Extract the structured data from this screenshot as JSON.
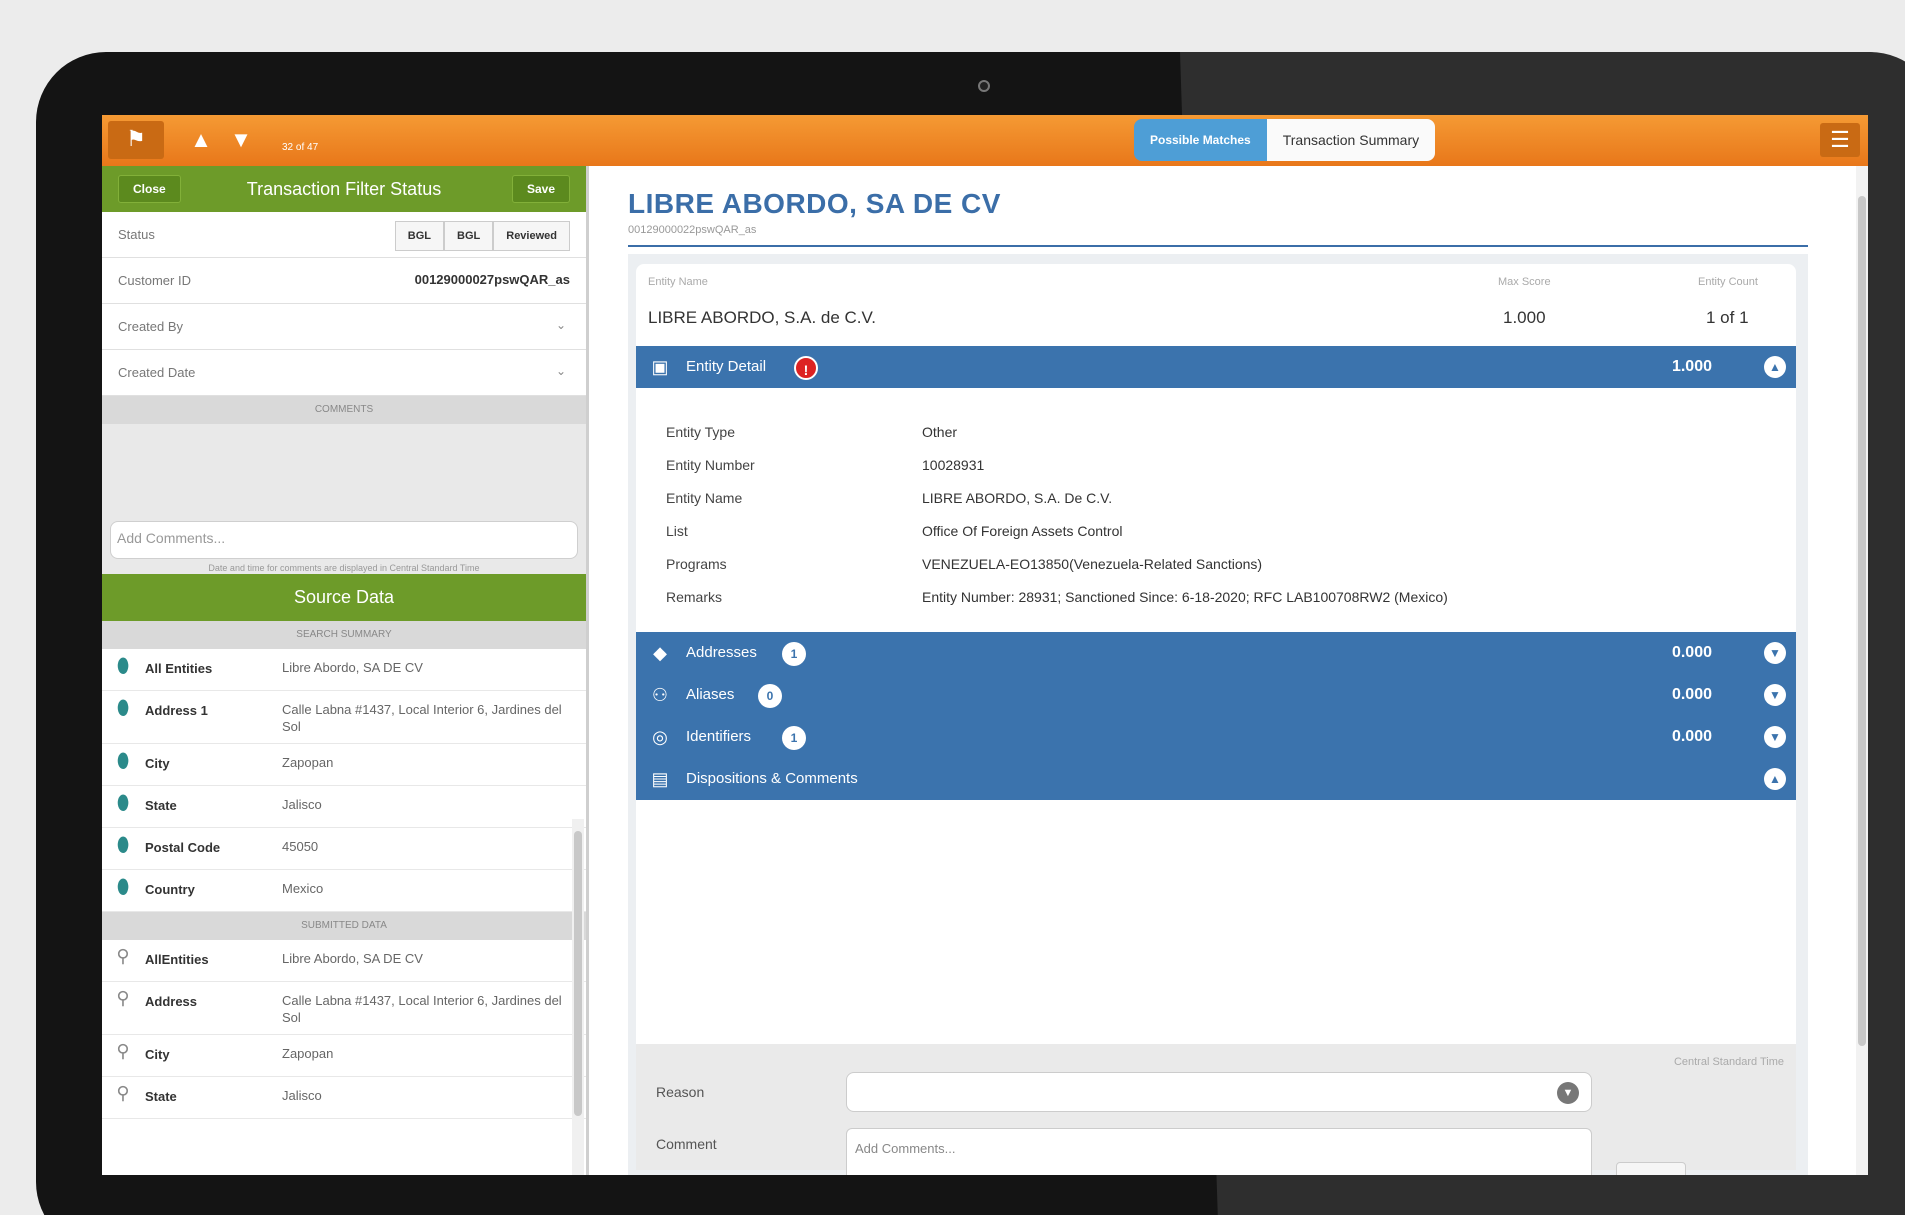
{
  "topbar": {
    "flag_icon": "flag-icon",
    "counter": "32 of 47",
    "tabs": [
      {
        "label": "Possible Matches",
        "active": true
      },
      {
        "label": "Transaction Summary",
        "active": false
      }
    ],
    "menu_icon": "hamburger-menu-icon"
  },
  "filter": {
    "close_label": "Close",
    "title": "Transaction Filter Status",
    "save_label": "Save",
    "status_label": "Status",
    "status_buttons": [
      "BGL",
      "BGL",
      "Reviewed"
    ],
    "customer_id_label": "Customer ID",
    "customer_id_value": "00129000027pswQAR_as",
    "created_by_label": "Created By",
    "created_date_label": "Created Date",
    "comments_header": "COMMENTS",
    "comment_placeholder": "Add Comments...",
    "comment_note": "Date and time for comments are displayed in Central Standard Time"
  },
  "source": {
    "title": "Source Data",
    "search_summary_header": "SEARCH SUMMARY",
    "search_rows": [
      {
        "key": "All Entities",
        "value": "Libre Abordo, SA DE CV"
      },
      {
        "key": "Address 1",
        "value": "Calle Labna #1437, Local Interior 6, Jardines del Sol"
      },
      {
        "key": "City",
        "value": "Zapopan"
      },
      {
        "key": "State",
        "value": "Jalisco"
      },
      {
        "key": "Postal Code",
        "value": "45050"
      },
      {
        "key": "Country",
        "value": "Mexico"
      }
    ],
    "submitted_header": "SUBMITTED DATA",
    "submitted_rows": [
      {
        "key": "AllEntities",
        "value": "Libre Abordo, SA DE CV"
      },
      {
        "key": "Address",
        "value": "Calle Labna #1437, Local Interior 6, Jardines del Sol"
      },
      {
        "key": "City",
        "value": "Zapopan"
      },
      {
        "key": "State",
        "value": "Jalisco"
      }
    ]
  },
  "main": {
    "title": "LIBRE ABORDO, SA DE CV",
    "subtitle": "00129000022pswQAR_as",
    "entity_name_label": "Entity Name",
    "entity_name_value": "LIBRE ABORDO, S.A. de C.V.",
    "max_score_label": "Max Score",
    "max_score_value": "1.000",
    "entity_count_label": "Entity Count",
    "entity_count_value": "1 of 1",
    "sections": {
      "entity_detail": {
        "label": "Entity Detail",
        "badge": "!",
        "score": "1.000",
        "icon": "contact-card-icon",
        "expanded": true
      },
      "addresses": {
        "label": "Addresses",
        "badge": "1",
        "score": "0.000",
        "icon": "location-diamond-icon",
        "expanded": false
      },
      "aliases": {
        "label": "Aliases",
        "badge": "0",
        "score": "0.000",
        "icon": "people-icon",
        "expanded": false
      },
      "identifiers": {
        "label": "Identifiers",
        "badge": "1",
        "score": "0.000",
        "icon": "fingerprint-icon",
        "expanded": false
      },
      "dispositions": {
        "label": "Dispositions & Comments",
        "icon": "document-icon",
        "expanded": true
      }
    },
    "details": [
      {
        "key": "Entity Type",
        "value": "Other"
      },
      {
        "key": "Entity Number",
        "value": "10028931"
      },
      {
        "key": "Entity Name",
        "value": "LIBRE ABORDO, S.A. De C.V."
      },
      {
        "key": "List",
        "value": "Office Of Foreign Assets Control"
      },
      {
        "key": "Programs",
        "value": "VENEZUELA-EO13850(Venezuela-Related Sanctions)"
      },
      {
        "key": "Remarks",
        "value": "Entity Number: 28931; Sanctioned Since: 6-18-2020; RFC LAB100708RW2 (Mexico)"
      }
    ],
    "disposition": {
      "timezone_note": "Central Standard Time",
      "reason_label": "Reason",
      "comment_label": "Comment",
      "comment_placeholder": "Add Comments..."
    }
  },
  "colors": {
    "topbar_orange": "#e8771a",
    "green": "#6d9b29",
    "blue_bar": "#3b73ad",
    "title_blue": "#3b6ea8",
    "alert_red": "#dd2222"
  }
}
